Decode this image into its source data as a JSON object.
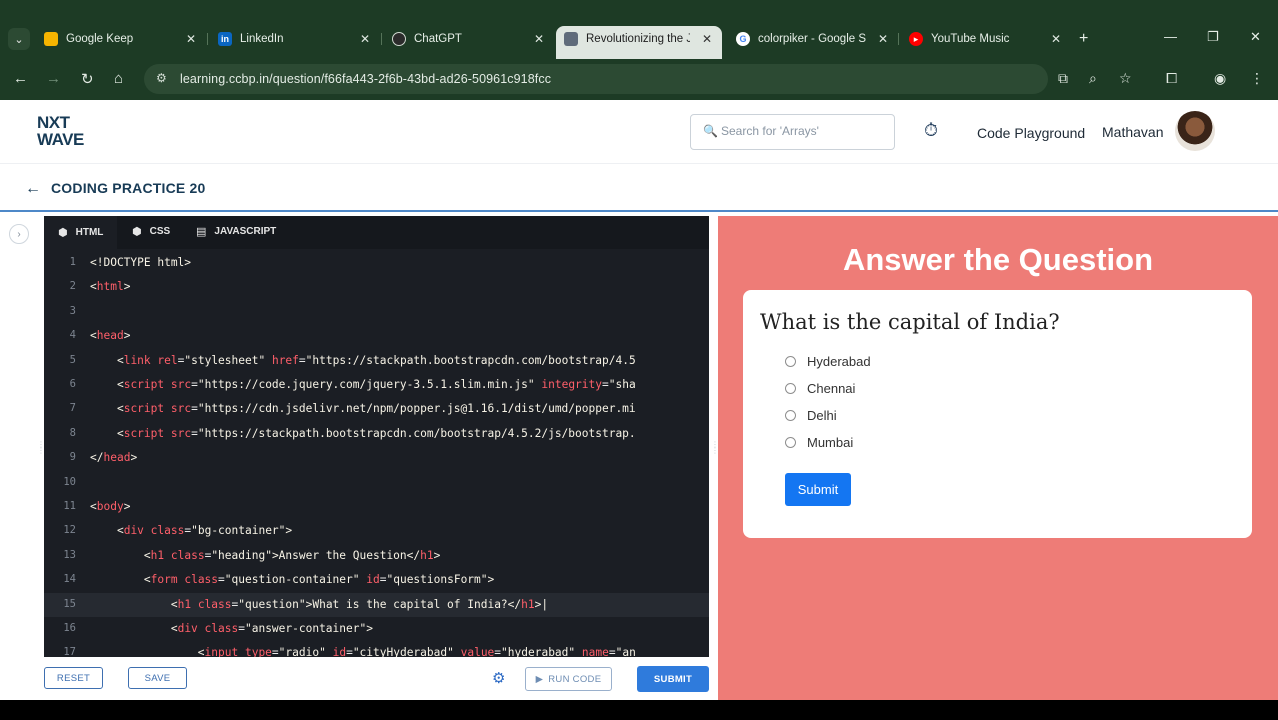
{
  "browser": {
    "tabs": [
      {
        "title": "Google Keep",
        "favicon": "google-keep-icon",
        "color": "#f6b400"
      },
      {
        "title": "LinkedIn",
        "favicon": "linkedin-icon",
        "color": "#0a66c2"
      },
      {
        "title": "ChatGPT",
        "favicon": "chatgpt-icon",
        "color": "#2b2b2b"
      },
      {
        "title": "Revolutionizing the J",
        "favicon": "page-icon",
        "color": "#5f6b7a"
      },
      {
        "title": "colorpiker - Google S",
        "favicon": "google-icon",
        "color": "#ffffff"
      },
      {
        "title": "YouTube Music",
        "favicon": "youtube-music-icon",
        "color": "#ff0000"
      }
    ],
    "close_glyph": "✕",
    "url": "learning.ccbp.in/question/f66fa443-2f6b-43bd-ad26-50961c918fcc"
  },
  "header": {
    "logo_line1": "NXT",
    "logo_line2": "WAVE",
    "search_placeholder": "Search for 'Arrays'",
    "playground": "Code Playground",
    "username": "Mathavan"
  },
  "subheader": {
    "title": "CODING PRACTICE 20"
  },
  "editor": {
    "tabs": [
      "HTML",
      "CSS",
      "JAVASCRIPT"
    ],
    "lines": [
      {
        "n": "1",
        "html": "<span class='st'>&lt;!DOCTYPE html&gt;</span>"
      },
      {
        "n": "2",
        "html": "<span class='st'>&lt;</span><span class='tg'>html</span><span class='st'>&gt;</span>"
      },
      {
        "n": "3",
        "html": ""
      },
      {
        "n": "4",
        "html": "<span class='st'>&lt;</span><span class='tg'>head</span><span class='st'>&gt;</span>"
      },
      {
        "n": "5",
        "html": "    <span class='st'>&lt;</span><span class='tg'>link</span> <span class='at'>rel</span>=<span class='st'>\"stylesheet\"</span> <span class='at'>href</span>=<span class='st'>\"https://stackpath.bootstrapcdn.com/bootstrap/4.5</span>"
      },
      {
        "n": "6",
        "html": "    <span class='st'>&lt;</span><span class='tg'>script</span> <span class='at'>src</span>=<span class='st'>\"https://code.jquery.com/jquery-3.5.1.slim.min.js\"</span> <span class='at'>integrity</span>=<span class='st'>\"sha</span>"
      },
      {
        "n": "7",
        "html": "    <span class='st'>&lt;</span><span class='tg'>script</span> <span class='at'>src</span>=<span class='st'>\"https://cdn.jsdelivr.net/npm/popper.js@1.16.1/dist/umd/popper.mi</span>"
      },
      {
        "n": "8",
        "html": "    <span class='st'>&lt;</span><span class='tg'>script</span> <span class='at'>src</span>=<span class='st'>\"https://stackpath.bootstrapcdn.com/bootstrap/4.5.2/js/bootstrap.</span>"
      },
      {
        "n": "9",
        "html": "<span class='st'>&lt;/</span><span class='tg'>head</span><span class='st'>&gt;</span>"
      },
      {
        "n": "10",
        "html": ""
      },
      {
        "n": "11",
        "html": "<span class='st'>&lt;</span><span class='tg'>body</span><span class='st'>&gt;</span>"
      },
      {
        "n": "12",
        "html": "    <span class='st'>&lt;</span><span class='tg'>div</span> <span class='at'>class</span>=<span class='st'>\"bg-container\"</span><span class='st'>&gt;</span>"
      },
      {
        "n": "13",
        "html": "        <span class='st'>&lt;</span><span class='tg'>h1</span> <span class='at'>class</span>=<span class='st'>\"heading\"</span><span class='st'>&gt;Answer the Question&lt;/</span><span class='tg'>h1</span><span class='st'>&gt;</span>"
      },
      {
        "n": "14",
        "html": "        <span class='st'>&lt;</span><span class='tg'>form</span> <span class='at'>class</span>=<span class='st'>\"question-container\"</span> <span class='at'>id</span>=<span class='st'>\"questionsForm\"</span><span class='st'>&gt;</span>"
      },
      {
        "n": "15",
        "html": "            <span class='st'>&lt;</span><span class='tg'>h1</span> <span class='at'>class</span>=<span class='st'>\"question\"</span><span class='st'>&gt;What is the capital of India?&lt;/</span><span class='tg'>h1</span><span class='st'>&gt;|</span>"
      },
      {
        "n": "16",
        "html": "            <span class='st'>&lt;</span><span class='tg'>div</span> <span class='at'>class</span>=<span class='st'>\"answer-container\"</span><span class='st'>&gt;</span>"
      },
      {
        "n": "17",
        "html": "                <span class='st'>&lt;</span><span class='tg'>input</span> <span class='at'>type</span>=<span class='st'>\"radio\"</span> <span class='at'>id</span>=<span class='st'>\"cityHyderabad\"</span> <span class='at'>value</span>=<span class='st'>\"hyderabad\"</span> <span class='at'>name</span>=<span class='st'>\"an</span>"
      }
    ],
    "current_line": 15,
    "reset_label": "RESET",
    "save_label": "SAVE",
    "run_label": "RUN CODE",
    "submit_label": "SUBMIT"
  },
  "preview": {
    "heading": "Answer the Question",
    "question": "What is the capital of India?",
    "options": [
      "Hyderabad",
      "Chennai",
      "Delhi",
      "Mumbai"
    ],
    "submit_label": "Submit",
    "bg_color": "#ee7c77"
  }
}
